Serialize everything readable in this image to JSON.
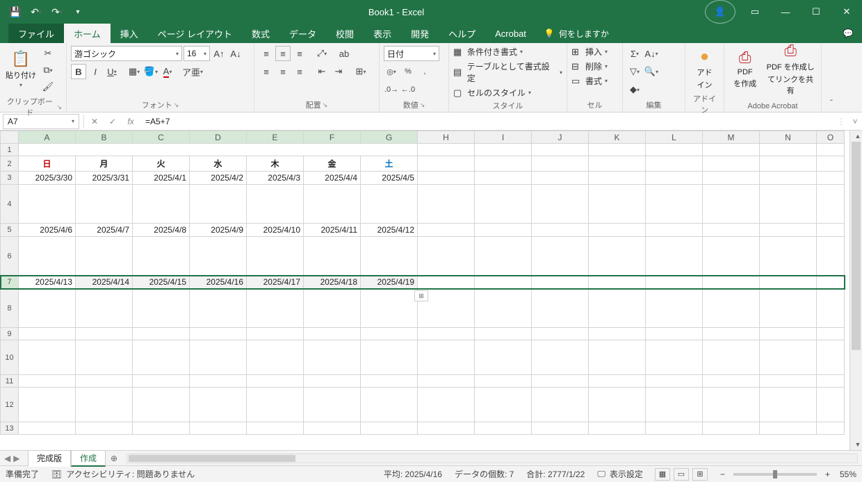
{
  "titlebar": {
    "title": "Book1  -  Excel"
  },
  "tabs": {
    "file": "ファイル",
    "home": "ホーム",
    "insert": "挿入",
    "layout": "ページ レイアウト",
    "formulas": "数式",
    "data": "データ",
    "review": "校閲",
    "view": "表示",
    "developer": "開発",
    "help": "ヘルプ",
    "acrobat": "Acrobat",
    "tell": "何をしますか"
  },
  "ribbon": {
    "clipboard": {
      "paste": "貼り付け",
      "label": "クリップボード"
    },
    "font": {
      "name": "游ゴシック",
      "size": "16",
      "label": "フォント",
      "bold": "B",
      "italic": "I",
      "underline": "U"
    },
    "align": {
      "label": "配置",
      "wrap_ico": "ab"
    },
    "number": {
      "format": "日付",
      "label": "数値"
    },
    "styles": {
      "cond": "条件付き書式",
      "table": "テーブルとして書式設定",
      "cell": "セルのスタイル",
      "label": "スタイル"
    },
    "cells": {
      "insert": "挿入",
      "delete": "削除",
      "format": "書式",
      "label": "セル"
    },
    "editing": {
      "label": "編集"
    },
    "addin": {
      "label_top": "アド",
      "label_bot": "イン",
      "group": "アドイン"
    },
    "acrobat": {
      "pdf1a": "PDF",
      "pdf1b": "を作成",
      "pdf2a": "PDF を作成し",
      "pdf2b": "てリンクを共有",
      "label": "Adobe Acrobat"
    }
  },
  "fbar": {
    "name": "A7",
    "formula": "=A5+7"
  },
  "cols": [
    "A",
    "B",
    "C",
    "D",
    "E",
    "F",
    "G",
    "H",
    "I",
    "J",
    "K",
    "L",
    "M",
    "N",
    "O"
  ],
  "rows": [
    "1",
    "2",
    "3",
    "4",
    "5",
    "6",
    "7",
    "8",
    "9",
    "10",
    "11",
    "12",
    "13"
  ],
  "days": [
    "日",
    "月",
    "火",
    "水",
    "木",
    "金",
    "土"
  ],
  "week1": [
    "2025/3/30",
    "2025/3/31",
    "2025/4/1",
    "2025/4/2",
    "2025/4/3",
    "2025/4/4",
    "2025/4/5"
  ],
  "week2": [
    "2025/4/6",
    "2025/4/7",
    "2025/4/8",
    "2025/4/9",
    "2025/4/10",
    "2025/4/11",
    "2025/4/12"
  ],
  "week3": [
    "2025/4/13",
    "2025/4/14",
    "2025/4/15",
    "2025/4/16",
    "2025/4/17",
    "2025/4/18",
    "2025/4/19"
  ],
  "sheets": {
    "s1": "完成版",
    "s2": "作成",
    "add": "⊕"
  },
  "status": {
    "ready": "準備完了",
    "acc_icon": "🗄",
    "acc": "アクセシビリティ: 問題ありません",
    "avg": "平均: 2025/4/16",
    "count": "データの個数: 7",
    "sum": "合計: 2777/1/22",
    "disp": "表示設定",
    "zoom": "55%"
  }
}
